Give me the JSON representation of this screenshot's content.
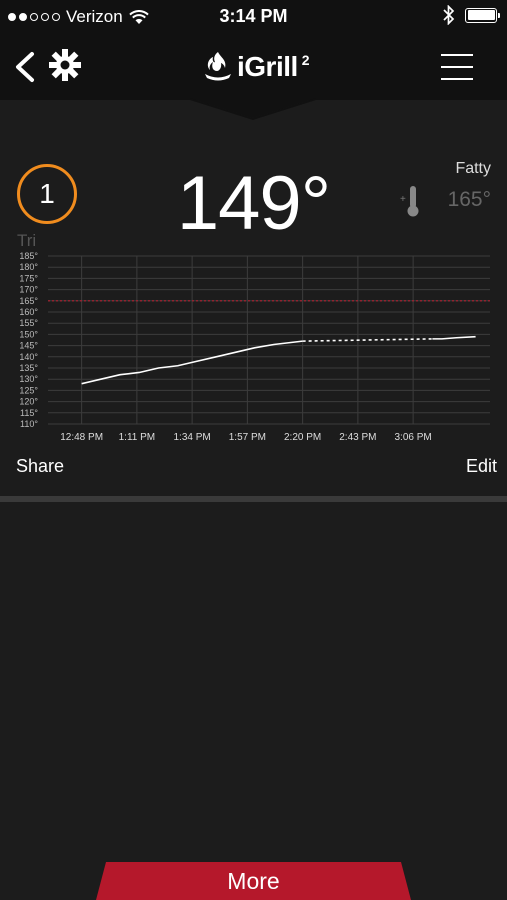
{
  "status_bar": {
    "carrier": "Verizon",
    "signal_icon": "signal-dots-icon",
    "wifi_icon": "wifi-icon",
    "time": "3:14 PM",
    "bluetooth_icon": "bluetooth-icon",
    "battery_icon": "battery-icon",
    "battery_level": 1.0
  },
  "nav": {
    "back_icon": "chevron-left-icon",
    "settings_icon": "gear-icon",
    "app_name": "iGrill",
    "app_version": "2",
    "menu_icon": "hamburger-menu-icon"
  },
  "probe": {
    "number": "1",
    "name": "Tri",
    "current_temp": "149°",
    "target_label": "Fatty",
    "target_temp": "165°",
    "ring_color": "#f08c1e"
  },
  "chart_data": {
    "type": "line",
    "title": "",
    "xlabel": "",
    "ylabel": "",
    "y_ticks": [
      "110°",
      "115°",
      "120°",
      "125°",
      "130°",
      "135°",
      "140°",
      "145°",
      "150°",
      "155°",
      "160°",
      "165°",
      "170°",
      "175°",
      "180°",
      "185°"
    ],
    "x_ticks": [
      "12:48 PM",
      "1:11 PM",
      "1:34 PM",
      "1:57 PM",
      "2:20 PM",
      "2:43 PM",
      "3:06 PM"
    ],
    "ylim": [
      110,
      185
    ],
    "target_line": 165,
    "target_color": "#b02030",
    "grid": true,
    "series": [
      {
        "solid_segments": [
          [
            [
              0,
              128
            ],
            [
              8,
              130
            ],
            [
              16,
              132
            ],
            [
              24,
              133
            ],
            [
              32,
              135
            ],
            [
              40,
              136
            ],
            [
              48,
              138
            ],
            [
              56,
              140
            ],
            [
              64,
              142
            ],
            [
              72,
              144
            ],
            [
              80,
              145.5
            ],
            [
              88,
              146.5
            ],
            [
              92,
              147
            ]
          ],
          [
            [
              146,
              148
            ],
            [
              150,
              148
            ],
            [
              156,
              148.5
            ],
            [
              164,
              149
            ]
          ]
        ],
        "dashed_segment": [
          [
            92,
            147
          ],
          [
            146,
            148
          ]
        ]
      }
    ],
    "x_range_minutes": [
      -14,
      170
    ]
  },
  "actions": {
    "share": "Share",
    "edit": "Edit"
  },
  "bottom": {
    "more": "More",
    "more_color": "#b5182b"
  }
}
